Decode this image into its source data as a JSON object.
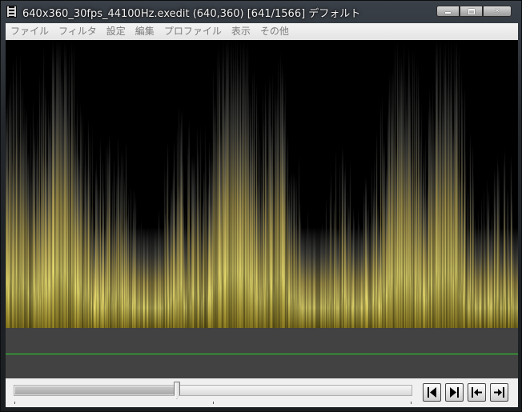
{
  "window": {
    "title": "640x360_30fps_44100Hz.exedit (640,360)  [641/1566]  デフォルト"
  },
  "caption_buttons": {
    "minimize_icon": "minimize-icon",
    "maximize_icon": "maximize-icon",
    "close_icon": "close-icon"
  },
  "menu": {
    "items": [
      "ファイル",
      "フィルタ",
      "設定",
      "編集",
      "プロファイル",
      "表示",
      "その他"
    ]
  },
  "playback": {
    "current_frame": 641,
    "total_frames": 1566,
    "position_fraction": 0.409
  },
  "navigation": {
    "icons": [
      "prev-frame-icon",
      "next-frame-icon",
      "first-frame-icon",
      "last-frame-icon"
    ]
  },
  "colors": {
    "preview_bg": "#000000",
    "wave_yellow": "#fff27a",
    "track_line": "#2ad62a",
    "client_bg": "#424242"
  }
}
